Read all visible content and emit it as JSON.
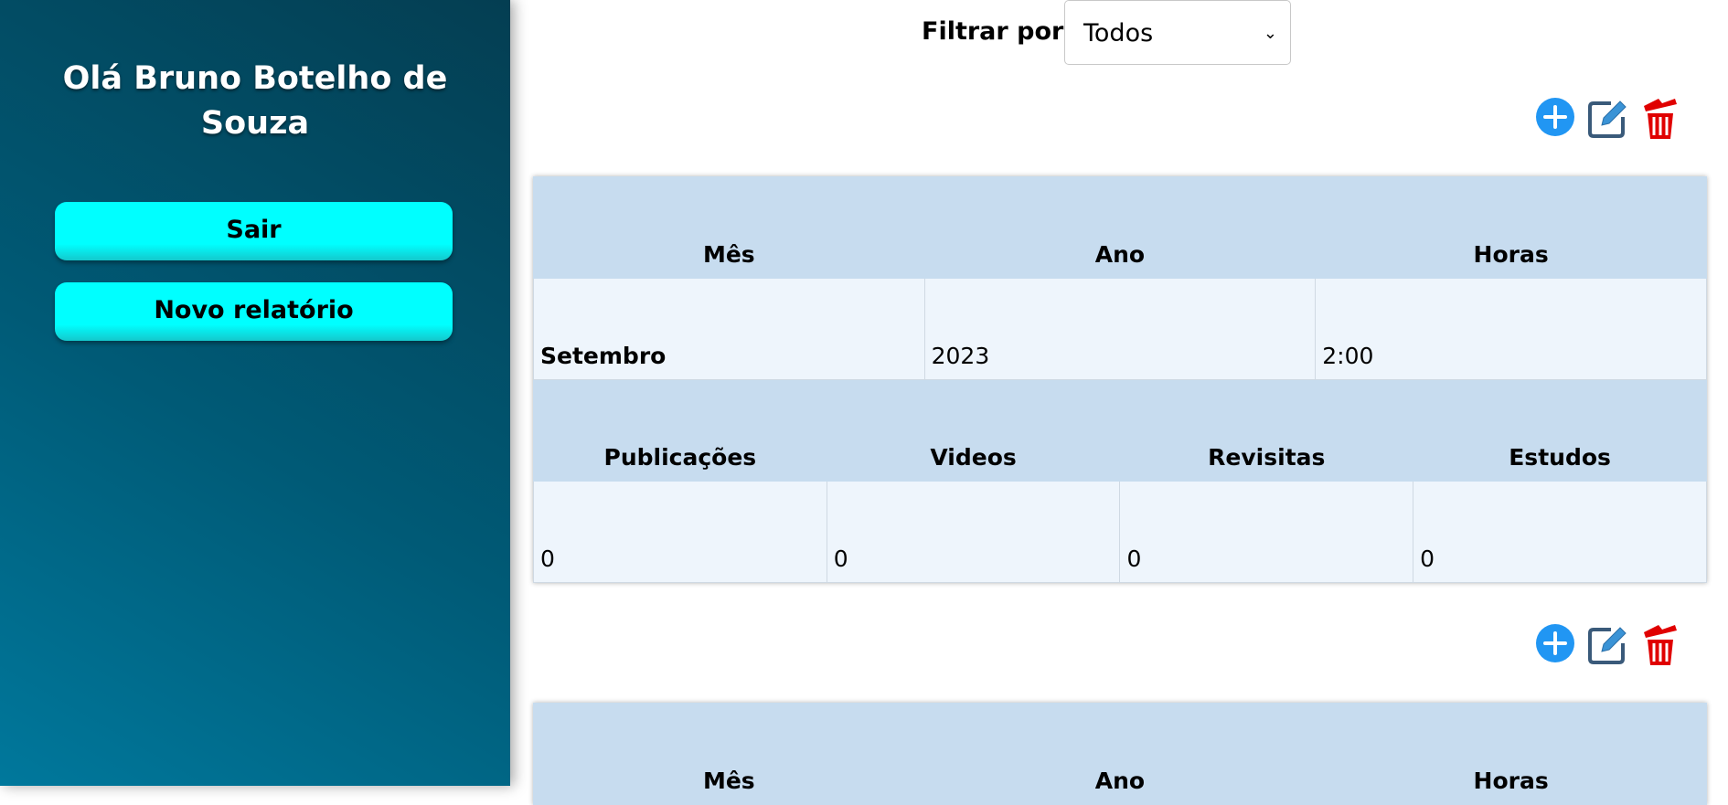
{
  "sidebar": {
    "greeting": "Olá Bruno Botelho de Souza",
    "logout_label": "Sair",
    "new_report_label": "Novo relatório"
  },
  "filter": {
    "label": "Filtrar por:",
    "selected": "Todos"
  },
  "colors": {
    "primary_button": "#00ffff",
    "header_row": "#c7dcef",
    "data_row": "#eef5fc",
    "add_icon": "#2196f3",
    "edit_icon": "#3a5a7a",
    "delete_icon": "#e00000"
  },
  "icons": {
    "add": "plus-circle-icon",
    "edit": "edit-icon",
    "delete": "trash-icon"
  },
  "reports": [
    {
      "headers1": [
        "Mês",
        "Ano",
        "Horas"
      ],
      "mes": "Setembro",
      "ano": "2023",
      "horas": "2:00",
      "headers2": [
        "Publicações",
        "Videos",
        "Revisitas",
        "Estudos"
      ],
      "publicacoes": "0",
      "videos": "0",
      "revisitas": "0",
      "estudos": "0"
    },
    {
      "headers1": [
        "Mês",
        "Ano",
        "Horas"
      ]
    }
  ]
}
